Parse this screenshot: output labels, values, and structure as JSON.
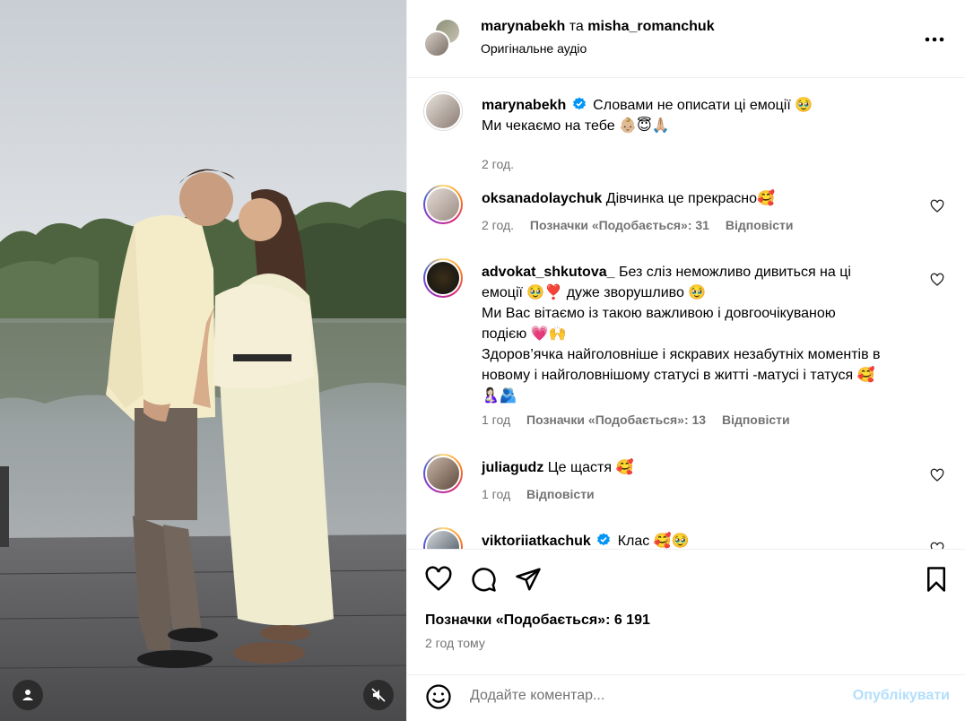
{
  "post": {
    "author": "marynabekh",
    "conjunction": "та",
    "coauthor": "misha_romanchuk",
    "audio": "Оригінальне аудіо",
    "more_icon": "more-horizontal-icon"
  },
  "caption": {
    "user": "marynabekh",
    "line1": "Словами не описати ці емоції 🥹",
    "line2": "Ми чекаємо на тебе 👶🏼😇🙏🏼",
    "time": "2 год."
  },
  "comments": [
    {
      "user": "oksanadolaychuk",
      "text": "Дівчинка це прекрасно🥰",
      "time": "2 год.",
      "likes": "Позначки «Подобається»: 31",
      "reply": "Відповісти"
    },
    {
      "user": "advokat_shkutova_",
      "line1": "Без сліз неможливо дивиться на ці",
      "line2": "емоції 🥹❣️ дуже зворушливо 🥹",
      "line3": "Ми Вас вітаємо із такою важливою і довгоочікуваною",
      "line4": "подією 💗🙌",
      "line5": "Здоров’ячка найголовніше і яскравих незабутніх моментів в",
      "line6": "новому і найголовнішому статусі в житті -матусі і татуся 🥰",
      "line7": "🤱🏻🫂",
      "time": "1 год",
      "likes": "Позначки «Подобається»: 13",
      "reply": "Відповісти"
    },
    {
      "user": "juliagudz",
      "text": "Це щастя 🥰",
      "time": "1 год",
      "reply": "Відповісти"
    },
    {
      "user": "viktoriiatkachuk",
      "text": "Клас 🥰🥹"
    }
  ],
  "footer": {
    "likes": "Позначки «Подобається»: 6 191",
    "ago": "2 год тому",
    "comment_placeholder": "Додайте коментар...",
    "publish": "Опублікувати"
  },
  "colors": {
    "verified": "#0095f6",
    "publish_disabled": "#b2dffc",
    "muted_text": "#737373"
  }
}
